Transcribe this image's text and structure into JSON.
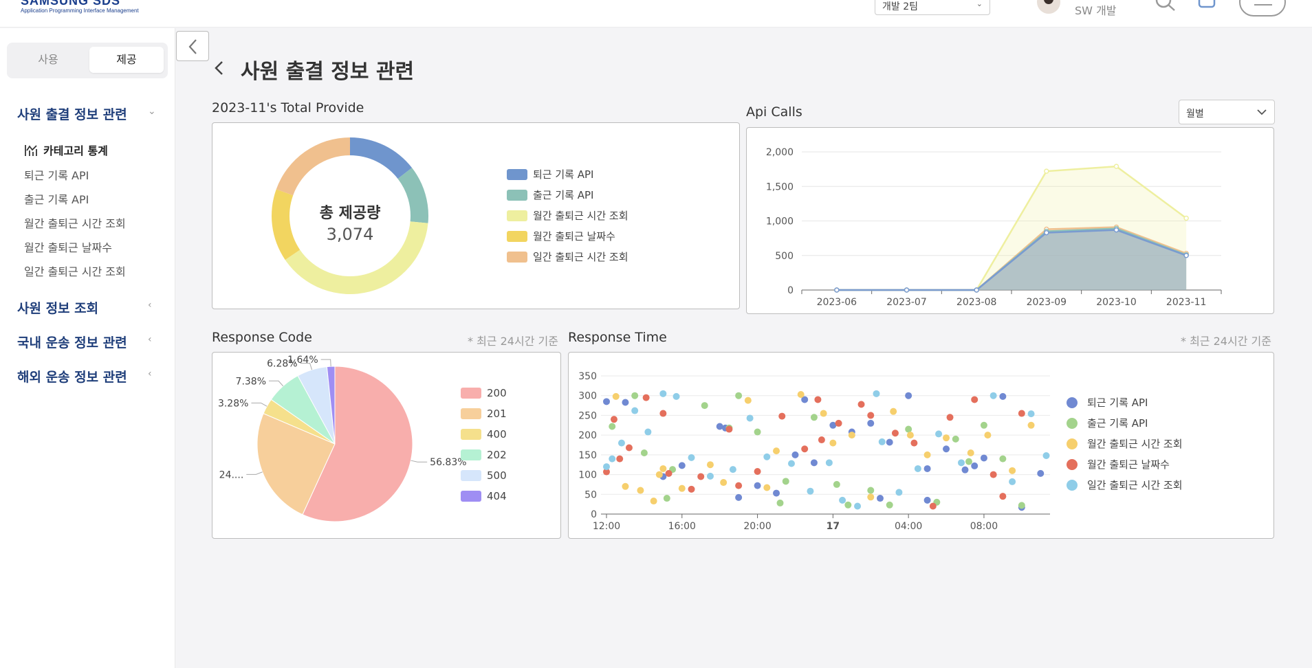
{
  "header": {
    "logo_main": "SAMSUNG SDS",
    "logo_sub": "Application Programming Interface Management",
    "team_select": "개발 2팀",
    "user_team": "SW 개발"
  },
  "sidebar": {
    "toggle": {
      "use": "사용",
      "provide": "제공"
    },
    "groups": [
      {
        "label": "사원 출결 정보 관련",
        "items": [
          "카테고리 통계",
          "퇴근 기록 API",
          "출근 기록 API",
          "월간 출퇴근 시간 조회",
          "월간 출퇴근 날짜수",
          "일간 출퇴근 시간 조회"
        ]
      },
      {
        "label": "사원 정보 조회"
      },
      {
        "label": "국내 운송 정보 관련"
      },
      {
        "label": "해외 운송 정보 관련"
      }
    ]
  },
  "page": {
    "title": "사원 출결 정보 관련"
  },
  "total_provide": {
    "title": "2023-11's Total Provide",
    "center_label": "총 제공량",
    "center_value": "3,074",
    "legend": [
      {
        "name": "퇴근 기록 API",
        "color": "#6f95cd"
      },
      {
        "name": "출근 기록 API",
        "color": "#8cc1b7"
      },
      {
        "name": "월간 출퇴근 시간 조회",
        "color": "#eeef9f"
      },
      {
        "name": "월간 출퇴근 날짜수",
        "color": "#f2d560"
      },
      {
        "name": "일간 출퇴근 시간 조회",
        "color": "#f0c08e"
      }
    ]
  },
  "api_calls": {
    "title": "Api Calls",
    "period_select": "월별"
  },
  "response_code": {
    "title": "Response Code",
    "note": "* 최근 24시간 기준",
    "legend": [
      {
        "name": "200",
        "color": "#f8aeac"
      },
      {
        "name": "201",
        "color": "#f7cf9b"
      },
      {
        "name": "400",
        "color": "#f5e08c"
      },
      {
        "name": "202",
        "color": "#b5f1d3"
      },
      {
        "name": "500",
        "color": "#d6e6fb"
      },
      {
        "name": "404",
        "color": "#9f8ef3"
      }
    ],
    "slice_labels": [
      "56.83%",
      "24....",
      "3.28%",
      "7.38%",
      "6.28%",
      "1.64%"
    ]
  },
  "response_time": {
    "title": "Response Time",
    "note": "* 최근 24시간 기준",
    "legend": [
      {
        "name": "퇴근 기록 API",
        "color": "#7089d2"
      },
      {
        "name": "출근 기록 API",
        "color": "#a3d38c"
      },
      {
        "name": "월간 출퇴근 시간 조회",
        "color": "#f6cf6d"
      },
      {
        "name": "월간 출퇴근 날짜수",
        "color": "#e46f5c"
      },
      {
        "name": "일간 출퇴근 시간 조회",
        "color": "#8fcde8"
      }
    ]
  },
  "chart_data": [
    {
      "type": "pie",
      "title": "2023-11's Total Provide",
      "categories": [
        "퇴근 기록 API",
        "출근 기록 API",
        "월간 출퇴근 시간 조회",
        "월간 출퇴근 날짜수",
        "일간 출퇴근 시간 조회"
      ],
      "values": [
        0.145,
        0.12,
        0.39,
        0.15,
        0.195
      ],
      "colors": [
        "#6f95cd",
        "#8cc1b7",
        "#eeef9f",
        "#f2d560",
        "#f0c08e"
      ],
      "legend": "right"
    },
    {
      "type": "area",
      "title": "Api Calls",
      "categories": [
        "2023-06",
        "2023-07",
        "2023-08",
        "2023-09",
        "2023-10",
        "2023-11"
      ],
      "ylim": [
        0,
        2000
      ],
      "yticks": [
        0,
        500,
        1000,
        1500,
        2000
      ],
      "ytick_labels": [
        "0",
        "500",
        "1,000",
        "1,500",
        "2,000"
      ],
      "series": [
        {
          "values": [
            0,
            0,
            0,
            1720,
            1790,
            1040
          ],
          "color": "#eeef9f"
        },
        {
          "values": [
            0,
            0,
            0,
            880,
            910,
            530
          ],
          "color": "#f0c08e"
        },
        {
          "values": [
            0,
            0,
            0,
            850,
            890,
            510
          ],
          "color": "#8cc1b7"
        },
        {
          "values": [
            0,
            0,
            0,
            830,
            870,
            500
          ],
          "color": "#7a9bd0"
        }
      ]
    },
    {
      "type": "pie",
      "title": "Response Code",
      "categories": [
        "200",
        "201",
        "400",
        "202",
        "500",
        "404"
      ],
      "values": [
        56.83,
        24.59,
        3.28,
        7.38,
        6.28,
        1.64
      ],
      "colors": [
        "#f8aeac",
        "#f7cf9b",
        "#f5e08c",
        "#b5f1d3",
        "#d6e6fb",
        "#9f8ef3"
      ],
      "legend": "right"
    },
    {
      "type": "scatter",
      "title": "Response Time",
      "ylim": [
        0,
        350
      ],
      "yticks": [
        0,
        50,
        100,
        150,
        200,
        250,
        300,
        350
      ],
      "xlim": [
        0,
        23.5
      ],
      "xticks": [
        0,
        4,
        8,
        12,
        16,
        20
      ],
      "xtick_labels": [
        "12:00",
        "16:00",
        "20:00",
        "17",
        "04:00",
        "08:00"
      ],
      "series": [
        {
          "name": "퇴근 기록 API",
          "color": "#7089d2",
          "points": [
            [
              0,
              285
            ],
            [
              1,
              283
            ],
            [
              3,
              95
            ],
            [
              4,
              123
            ],
            [
              6,
              222
            ],
            [
              7,
              42
            ],
            [
              8,
              72
            ],
            [
              9,
              53
            ],
            [
              10,
              150
            ],
            [
              11,
              130
            ],
            [
              12,
              225
            ],
            [
              13,
              208
            ],
            [
              14,
              230
            ],
            [
              15,
              182
            ],
            [
              16,
              300
            ],
            [
              17,
              115
            ],
            [
              17,
              35
            ],
            [
              18,
              165
            ],
            [
              19,
              112
            ],
            [
              19.5,
              122
            ],
            [
              20,
              142
            ],
            [
              21,
              298
            ],
            [
              22,
              17
            ],
            [
              23,
              103
            ],
            [
              6.3,
              218
            ],
            [
              10.5,
              290
            ],
            [
              14.5,
              40
            ]
          ]
        },
        {
          "name": "출근 기록 API",
          "color": "#a3d38c",
          "points": [
            [
              0.3,
              222
            ],
            [
              1.5,
              300
            ],
            [
              2,
              155
            ],
            [
              3.5,
              113
            ],
            [
              5.2,
              275
            ],
            [
              7,
              300
            ],
            [
              8,
              208
            ],
            [
              9.5,
              83
            ],
            [
              11,
              245
            ],
            [
              12.2,
              75
            ],
            [
              14,
              60
            ],
            [
              15,
              23
            ],
            [
              16,
              215
            ],
            [
              17.5,
              30
            ],
            [
              18.5,
              190
            ],
            [
              19.2,
              133
            ],
            [
              20,
              225
            ],
            [
              21,
              140
            ],
            [
              22,
              22
            ],
            [
              6.5,
              218
            ],
            [
              3.2,
              40
            ],
            [
              9.2,
              28
            ],
            [
              12.8,
              23
            ]
          ]
        },
        {
          "name": "월간 출퇴근 시간 조회",
          "color": "#f6cf6d",
          "points": [
            [
              0.5,
              298
            ],
            [
              1,
              70
            ],
            [
              2.5,
              33
            ],
            [
              3,
              115
            ],
            [
              4,
              65
            ],
            [
              5.5,
              125
            ],
            [
              6.2,
              80
            ],
            [
              7.5,
              288
            ],
            [
              8.5,
              67
            ],
            [
              9,
              160
            ],
            [
              10.3,
              303
            ],
            [
              11.5,
              255
            ],
            [
              12,
              180
            ],
            [
              13,
              200
            ],
            [
              14,
              43
            ],
            [
              15.2,
              260
            ],
            [
              16.1,
              200
            ],
            [
              17,
              150
            ],
            [
              18,
              193
            ],
            [
              19.3,
              155
            ],
            [
              20.2,
              200
            ],
            [
              21.5,
              110
            ],
            [
              22.5,
              225
            ],
            [
              1.8,
              60
            ],
            [
              2.8,
              100
            ]
          ]
        },
        {
          "name": "월간 출퇴근 날짜수",
          "color": "#e46f5c",
          "points": [
            [
              0,
              107
            ],
            [
              0.4,
              240
            ],
            [
              0.7,
              140
            ],
            [
              1.2,
              168
            ],
            [
              2.1,
              295
            ],
            [
              3,
              255
            ],
            [
              4.5,
              63
            ],
            [
              5,
              95
            ],
            [
              6.5,
              215
            ],
            [
              7,
              72
            ],
            [
              8,
              108
            ],
            [
              9.3,
              248
            ],
            [
              10.5,
              165
            ],
            [
              11.2,
              290
            ],
            [
              12.3,
              230
            ],
            [
              13.5,
              278
            ],
            [
              14,
              250
            ],
            [
              15.3,
              205
            ],
            [
              16.3,
              180
            ],
            [
              17.3,
              20
            ],
            [
              18.2,
              245
            ],
            [
              19.5,
              290
            ],
            [
              20.5,
              100
            ],
            [
              21,
              45
            ],
            [
              22,
              255
            ],
            [
              11.4,
              188
            ],
            [
              3.3,
              103
            ]
          ]
        },
        {
          "name": "일간 출퇴근 시간 조회",
          "color": "#8fcde8",
          "points": [
            [
              0,
              120
            ],
            [
              0.8,
              180
            ],
            [
              1.5,
              262
            ],
            [
              2.2,
              208
            ],
            [
              3,
              305
            ],
            [
              3.7,
              298
            ],
            [
              4.5,
              143
            ],
            [
              5.5,
              96
            ],
            [
              6.7,
              113
            ],
            [
              7.6,
              243
            ],
            [
              8.5,
              145
            ],
            [
              9.8,
              128
            ],
            [
              10.8,
              58
            ],
            [
              11.8,
              130
            ],
            [
              12.5,
              35
            ],
            [
              13.3,
              20
            ],
            [
              14.3,
              305
            ],
            [
              15.5,
              55
            ],
            [
              16.5,
              115
            ],
            [
              17.6,
              203
            ],
            [
              18.8,
              130
            ],
            [
              20.5,
              300
            ],
            [
              21.5,
              82
            ],
            [
              22.5,
              254
            ],
            [
              23.3,
              148
            ],
            [
              0.3,
              140
            ],
            [
              14.6,
              183
            ]
          ]
        }
      ],
      "legend": "right"
    }
  ]
}
